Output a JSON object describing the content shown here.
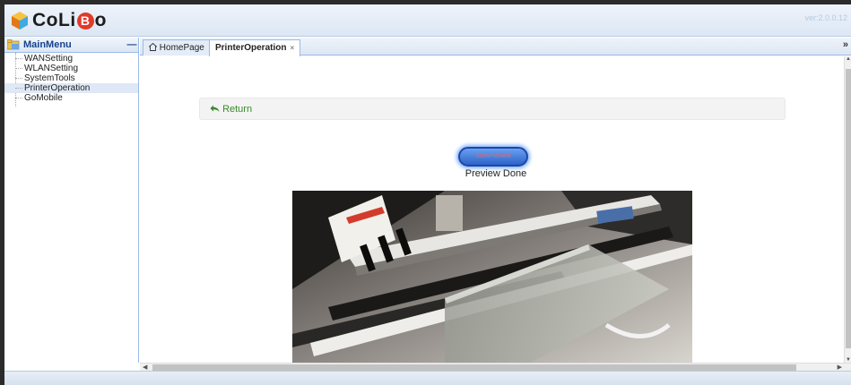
{
  "app": {
    "logo_text_left": "CoLi",
    "logo_text_b": "B",
    "logo_text_right": "o",
    "version": "ver:2.0.0.12"
  },
  "sidebar": {
    "title": "MainMenu",
    "collapse_glyph": "—",
    "items": [
      {
        "label": "WANSetting"
      },
      {
        "label": "WLANSetting"
      },
      {
        "label": "SystemTools"
      },
      {
        "label": "PrinterOperation",
        "selected": true
      },
      {
        "label": "GoMobile"
      }
    ]
  },
  "tabs": [
    {
      "label": "HomePage",
      "icon": "home-icon"
    },
    {
      "label": "PrinterOperation",
      "close": "×",
      "active": true
    }
  ],
  "tab_scroll_glyph": "»",
  "content": {
    "return_label": "Return",
    "preview_button_label": "StartPreview",
    "preview_status": "Preview Done",
    "camera_image": "printer-camera-preview"
  },
  "colors": {
    "accent": "#15428b",
    "return_green": "#3a8a2c",
    "button_blue": "#2d63c8",
    "logo_orange": "#f4a21c"
  }
}
